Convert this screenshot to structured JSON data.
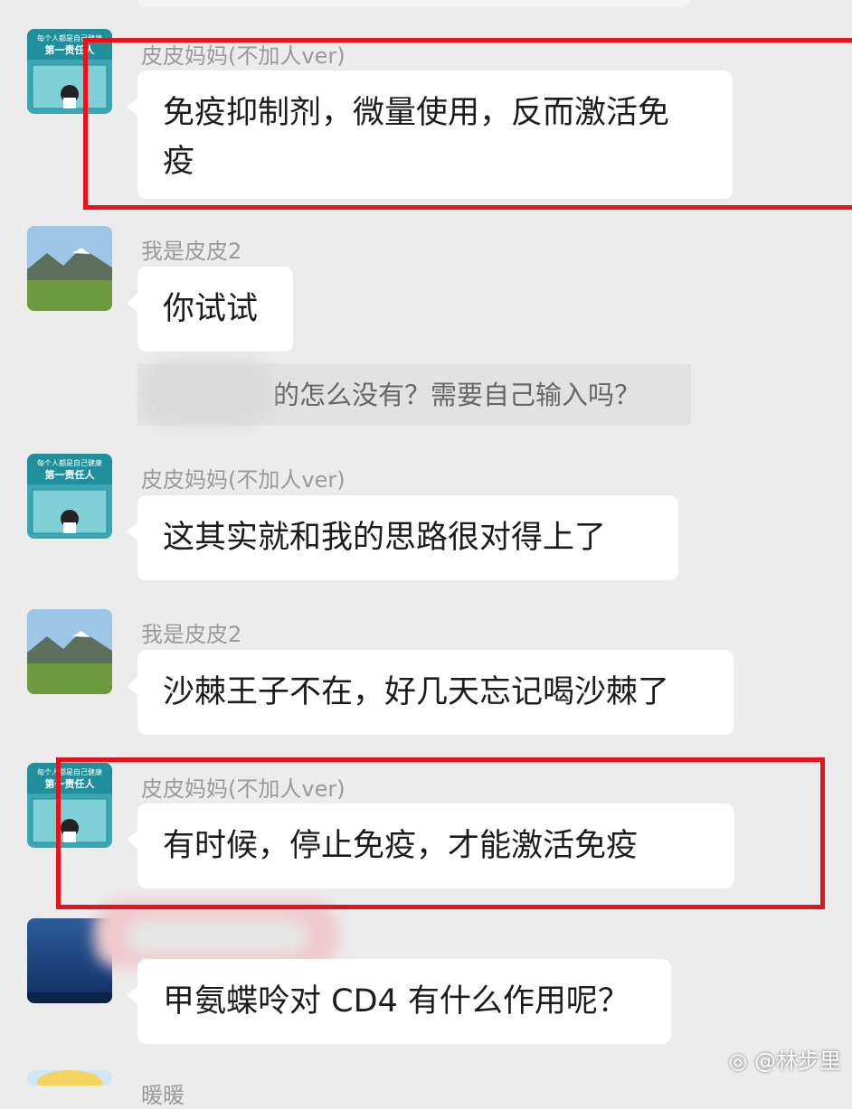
{
  "messages": [
    {
      "sender": "皮皮妈妈(不加人ver)",
      "text_lines": [
        "免疫抑制剂，微量使用，反而激活免",
        "疫"
      ]
    },
    {
      "sender": "我是皮皮2",
      "text_lines": [
        "你试试"
      ]
    },
    {
      "sender": "皮皮妈妈(不加人ver)",
      "text_lines": [
        "这其实就和我的思路很对得上了"
      ]
    },
    {
      "sender": "我是皮皮2",
      "text_lines": [
        "沙棘王子不在，好几天忘记喝沙棘了"
      ]
    },
    {
      "sender": "皮皮妈妈(不加人ver)",
      "text_lines": [
        "有时候，停止免疫，才能激活免疫"
      ]
    },
    {
      "sender": "",
      "text_lines": [
        "甲氨蝶呤对 CD4 有什么作用呢？"
      ]
    },
    {
      "sender": "暖暖"
    }
  ],
  "quote": {
    "text": "的怎么没有？需要自己输入吗？"
  },
  "avatar_banner": {
    "line1": "每个人都是自己健康",
    "line2": "第一责任人"
  },
  "watermark": {
    "text": "@林步里"
  },
  "colors": {
    "background": "#ececec",
    "bubble": "#ffffff",
    "highlight_box": "#e8121a",
    "sender": "#9a9a9a"
  }
}
